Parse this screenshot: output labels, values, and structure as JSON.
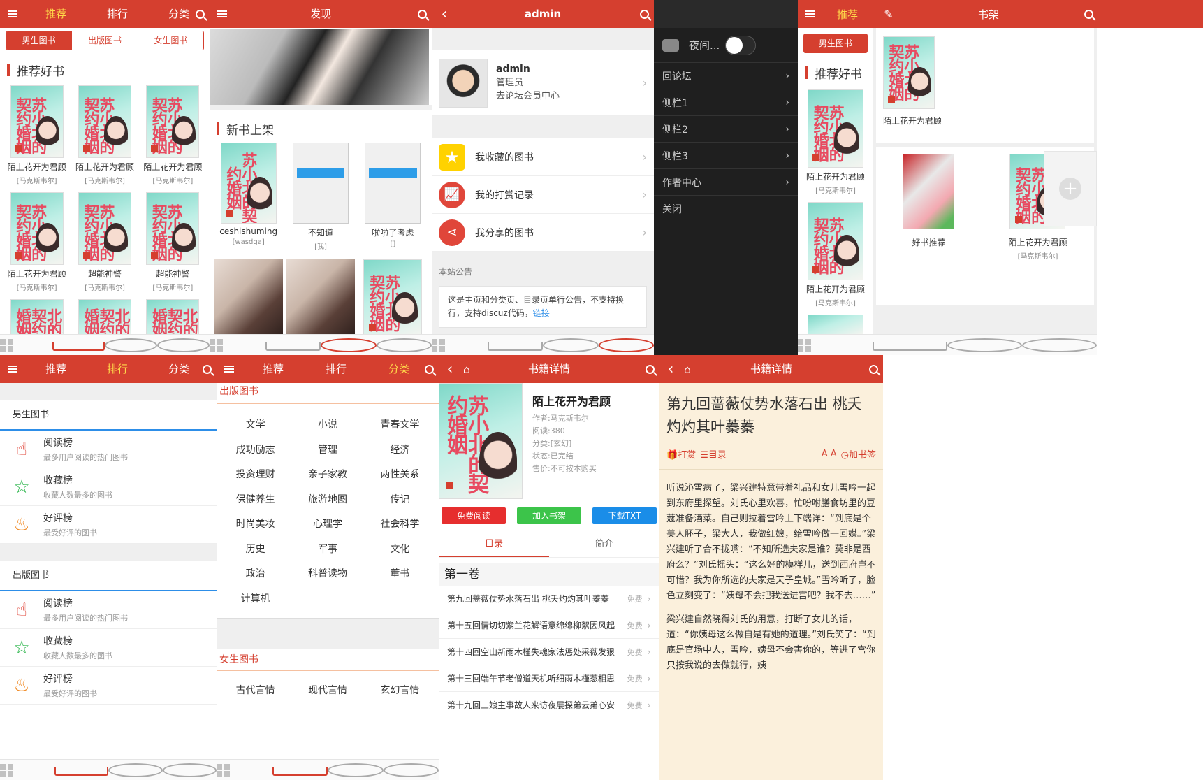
{
  "p1": {
    "tabs": [
      "推荐",
      "排行",
      "分类"
    ],
    "seg": [
      "男生图书",
      "出版图书",
      "女生图书"
    ],
    "section": "推荐好书",
    "books": [
      {
        "title": "陌上花开为君顾",
        "author": "[马克斯韦尔]"
      },
      {
        "title": "陌上花开为君顾",
        "author": "[马克斯韦尔]"
      },
      {
        "title": "陌上花开为君顾",
        "author": "[马克斯韦尔]"
      },
      {
        "title": "陌上花开为君顾",
        "author": "[马克斯韦尔]"
      },
      {
        "title": "超能神警",
        "author": "[马克斯韦尔]"
      },
      {
        "title": "超能神警",
        "author": "[马克斯韦尔]"
      }
    ],
    "cover_title": "苏小北的契约婚姻"
  },
  "p2": {
    "title": "发现",
    "section": "新书上架",
    "books": [
      {
        "title": "ceshishuming",
        "author": "[wasdga]"
      },
      {
        "title": "不知道",
        "author": "[我]"
      },
      {
        "title": "啦啦了考虑",
        "author": "[]"
      }
    ]
  },
  "p3": {
    "title": "admin",
    "username": "admin",
    "role": "管理员",
    "link": "去论坛会员中心",
    "menu": [
      "我收藏的图书",
      "我的打赏记录",
      "我分享的图书"
    ],
    "notice_title": "本站公告",
    "notice_text": "这是主页和分类页、目录页单行公告，不支持换行，支持discuz代码，",
    "notice_link": "链接"
  },
  "p4": {
    "night": "夜间...",
    "items": [
      "回论坛",
      "侧栏1",
      "侧栏2",
      "侧栏3",
      "作者中心",
      "关闭"
    ]
  },
  "p5": {
    "tab": "推荐",
    "seg": "男生图书",
    "section": "推荐好书",
    "books": [
      {
        "title": "陌上花开为君顾",
        "author": "[马克斯韦尔]"
      },
      {
        "title": "陌上花开为君顾",
        "author": "[马克斯韦尔]"
      }
    ],
    "shelf_title": "书架",
    "shelf_top": "陌上花开为君顾",
    "shelf": [
      {
        "title": "好书推荐",
        "author": ""
      },
      {
        "title": "陌上花开为君顾",
        "author": "[马克斯韦尔]"
      }
    ]
  },
  "p6": {
    "tabs": [
      "推荐",
      "排行",
      "分类"
    ],
    "group1": "男生图书",
    "group2": "出版图书",
    "ranks": [
      {
        "title": "阅读榜",
        "sub": "最多用户阅读的热门图书"
      },
      {
        "title": "收藏榜",
        "sub": "收藏人数最多的图书"
      },
      {
        "title": "好评榜",
        "sub": "最受好评的图书"
      }
    ]
  },
  "p7": {
    "tabs": [
      "推荐",
      "排行",
      "分类"
    ],
    "group1": "出版图书",
    "cats1": [
      "文学",
      "小说",
      "青春文学",
      "成功励志",
      "管理",
      "经济",
      "投资理财",
      "亲子家教",
      "两性关系",
      "保健养生",
      "旅游地图",
      "传记",
      "时尚美妆",
      "心理学",
      "社会科学",
      "历史",
      "军事",
      "文化",
      "政治",
      "科普读物",
      "董书",
      "计算机"
    ],
    "group2": "女生图书",
    "cats2": [
      "古代言情",
      "现代言情",
      "玄幻言情"
    ]
  },
  "p8": {
    "title": "书籍详情",
    "book_title": "陌上花开为君顾",
    "author": "作者:马克斯韦尔",
    "reads": "阅读:380",
    "category": "分类:[玄幻]",
    "status": "状态:已完结",
    "price": "售价:不可按本购买",
    "btn_read": "免费阅读",
    "btn_shelf": "加入书架",
    "btn_txt": "下载TXT",
    "tab_toc": "目录",
    "tab_intro": "简介",
    "volume": "第一卷",
    "free": "免费",
    "chapters": [
      "第九回蔷薇仗势水落石出 桃夭灼灼其叶蓁蓁",
      "第十五回情切切紫兰花解语意绵绵柳絮因风起",
      "第十四回空山新雨木槿失魂家法惩处采薇发狠",
      "第十三回端午节老僧道天机听细雨木槿惹相思",
      "第十九回三娘主事故人来访夜展探弟云弟心安"
    ]
  },
  "p9": {
    "title": "书籍详情",
    "chapter_title": "第九回蔷薇仗势水落石出 桃夭灼灼其叶蓁蓁",
    "reward": "打赏",
    "toc": "目录",
    "font": "A A",
    "bookmark": "加书签",
    "para1": "听说沁雪病了，梁兴建特意带着礼品和女儿雪吟一起到东府里探望。刘氏心里欢喜，忙吩咐膳食坊里的豆蔻准备酒菜。自己则拉着雪吟上下端详：“到底是个美人胚子，梁大人，我做红娘，给雪吟做一回媒。”梁兴建听了合不拢嘴：“不知所选夫家是谁？莫非是西府么？”刘氏摇头：“这么好的模样儿，送到西府岂不可惜？我为你所选的夫家是天子皇城。”雪吟听了，脸色立刻变了：“姨母不会把我送进宫吧？我不去……”",
    "para2": "梁兴建自然晓得刘氏的用意，打断了女儿的话，道：“你姨母这么做自是有她的道理。”刘氏笑了：“到底是官场中人，雪吟，姨母不会害你的，等进了宫你只按我说的去做就行，姨"
  }
}
